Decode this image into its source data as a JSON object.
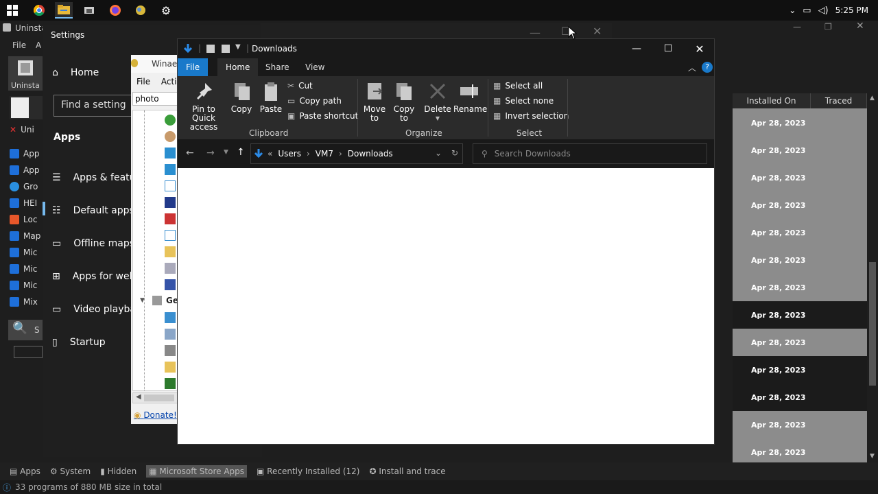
{
  "taskbar": {
    "clock": "5:25 PM",
    "icons": [
      "windows-start-icon",
      "chrome-icon",
      "file-explorer-icon",
      "app-icon",
      "firefox-icon",
      "app-icon-2",
      "settings-gear-icon"
    ]
  },
  "uninstaller": {
    "title": "Uninsta",
    "menu": [
      "File",
      "A"
    ],
    "left_items": [
      "Uninsta",
      "Uni",
      "App",
      "App",
      "Gro",
      "HEI",
      "Loc",
      "Map",
      "Mic",
      "Mic",
      "Mic",
      "Mix",
      "S"
    ],
    "columns": [
      "Installed On",
      "Traced"
    ],
    "rows": [
      "Apr 28, 2023",
      "Apr 28, 2023",
      "Apr 28, 2023",
      "Apr 28, 2023",
      "Apr 28, 2023",
      "Apr 28, 2023",
      "Apr 28, 2023",
      "Apr 28, 2023",
      "Apr 28, 2023",
      "Apr 28, 2023",
      "Apr 28, 2023",
      "Apr 28, 2023",
      "Apr 28, 2023"
    ],
    "bottom_tabs": [
      "Apps",
      "System",
      "Hidden",
      "Microsoft Store Apps",
      "Recently Installed (12)",
      "Install and trace"
    ],
    "status": "33 programs of 880 MB size in total"
  },
  "settings": {
    "title": "Settings",
    "home": "Home",
    "search_placeholder": "Find a setting",
    "section": "Apps",
    "items": [
      "Apps & featu",
      "Default apps",
      "Offline maps",
      "Apps for web",
      "Video playba",
      "Startup"
    ]
  },
  "winaero": {
    "title": "Winaer",
    "menu_file": "File",
    "menu_action": "Actic",
    "filter": "photo",
    "tree_group": "Ge",
    "donate": "Donate!"
  },
  "explorer": {
    "title": "Downloads",
    "tabs": [
      "File",
      "Home",
      "Share",
      "View"
    ],
    "ribbon": {
      "pin": [
        "Pin to Quick",
        "access"
      ],
      "copy": "Copy",
      "paste": "Paste",
      "cut": "Cut",
      "copy_path": "Copy path",
      "paste_shortcut": "Paste shortcut",
      "clipboard": "Clipboard",
      "move_to": [
        "Move",
        "to"
      ],
      "copy_to": [
        "Copy",
        "to"
      ],
      "delete": "Delete",
      "rename": "Rename",
      "organize": "Organize",
      "select_all": "Select all",
      "select_none": "Select none",
      "invert_selection": "Invert selection",
      "select": "Select"
    },
    "address": {
      "overflow": "«",
      "crumbs": [
        "Users",
        "VM7",
        "Downloads"
      ]
    },
    "search_placeholder": "Search Downloads"
  }
}
